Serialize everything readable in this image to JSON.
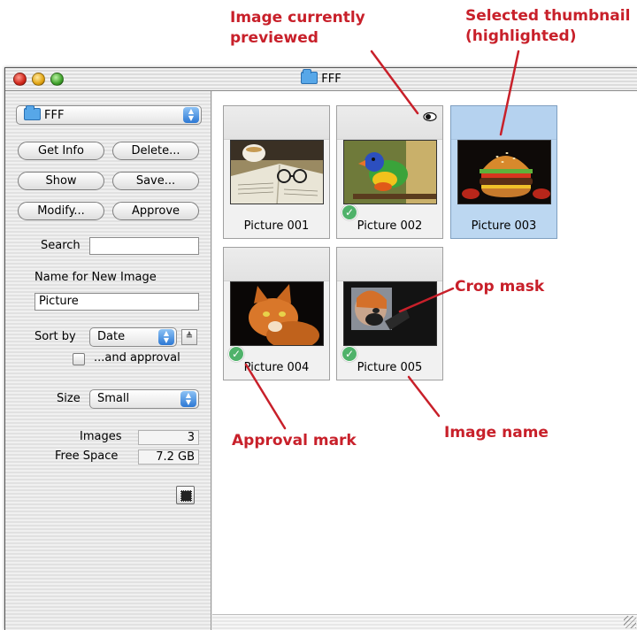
{
  "annotations": {
    "preview_line1": "Image currently",
    "preview_line2": "previewed",
    "selected_line1": "Selected thumbnail",
    "selected_line2": "(highlighted)",
    "crop_mask": "Crop mask",
    "image_name": "Image name",
    "approval_mark": "Approval mark"
  },
  "window": {
    "title": "FFF"
  },
  "sidebar": {
    "folder_popup": "FFF",
    "buttons": {
      "get_info": "Get Info",
      "delete": "Delete...",
      "show": "Show",
      "save": "Save...",
      "modify": "Modify...",
      "approve": "Approve"
    },
    "search_label": "Search",
    "search_value": "",
    "name_label": "Name for New Image",
    "name_value": "Picture",
    "sort_label": "Sort by",
    "sort_value": "Date",
    "approval_checkbox_label": "...and approval",
    "approval_checked": false,
    "size_label": "Size",
    "size_value": "Small",
    "images_label": "Images",
    "images_value": "3",
    "free_space_label": "Free Space",
    "free_space_value": "7.2 GB"
  },
  "thumbnails": [
    {
      "name": "Picture 001",
      "approved": false,
      "previewed": false,
      "selected": false,
      "subject": "book-and-teacup"
    },
    {
      "name": "Picture 002",
      "approved": true,
      "previewed": true,
      "selected": false,
      "subject": "parrot"
    },
    {
      "name": "Picture 003",
      "approved": false,
      "previewed": false,
      "selected": true,
      "subject": "hamburger"
    },
    {
      "name": "Picture 004",
      "approved": true,
      "previewed": false,
      "selected": false,
      "subject": "cat"
    },
    {
      "name": "Picture 005",
      "approved": true,
      "previewed": false,
      "selected": false,
      "subject": "cropped-portrait"
    }
  ],
  "colors": {
    "annotation": "#c8202a",
    "selection": "#bcd7f1",
    "approval": "#4fb26a"
  }
}
